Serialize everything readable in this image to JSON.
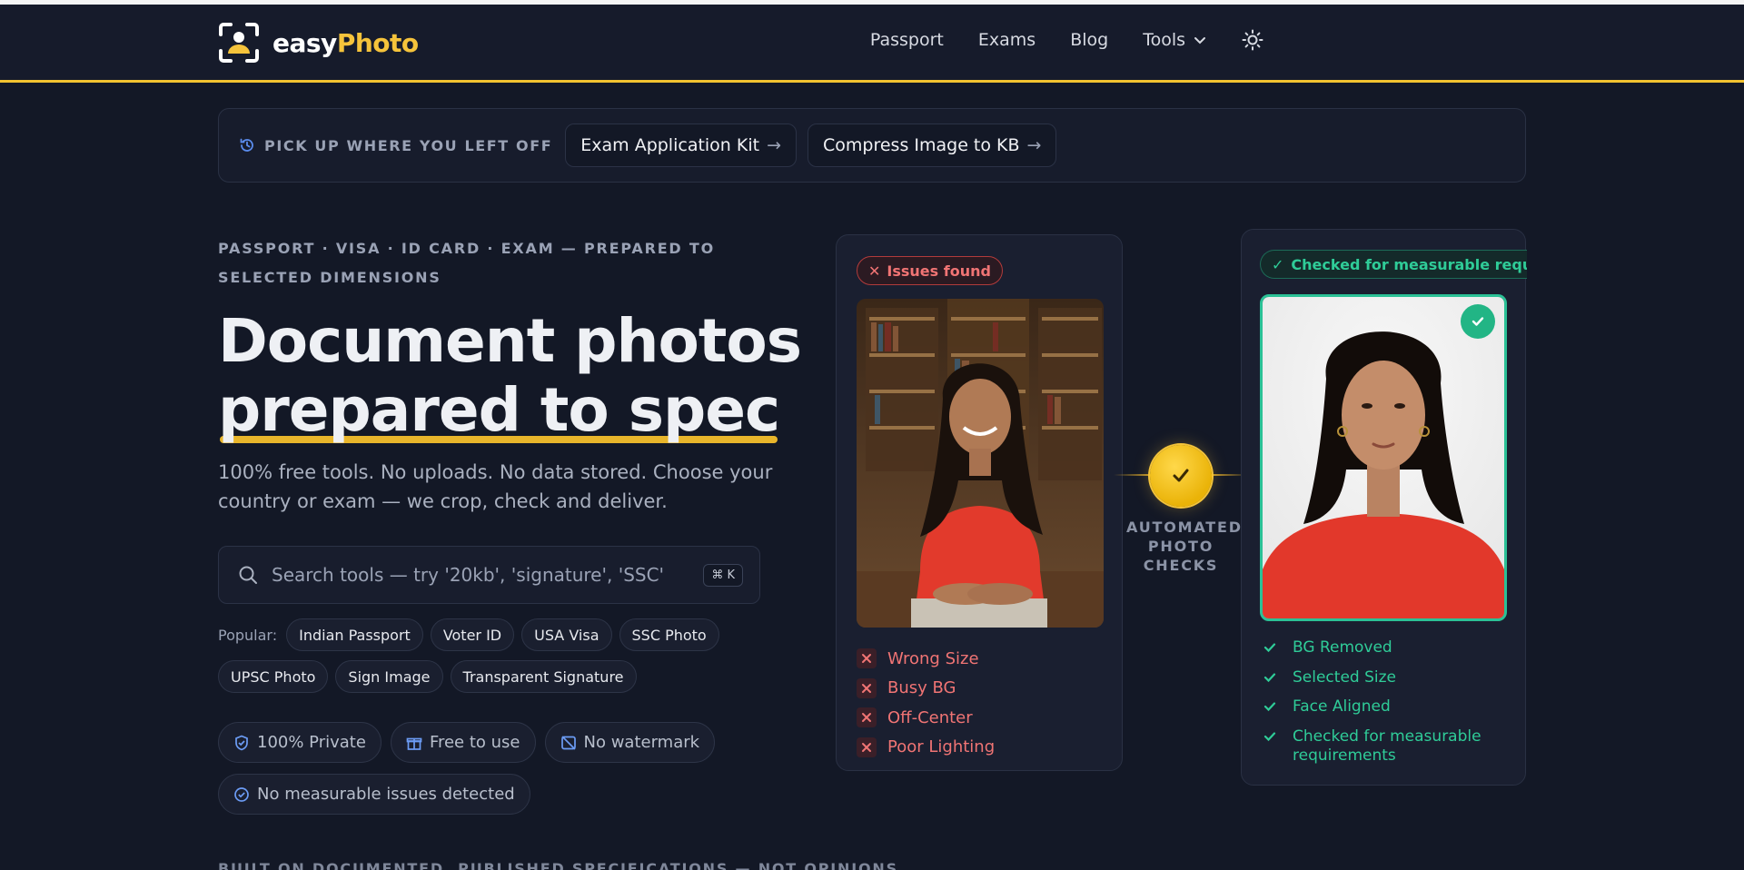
{
  "brand": {
    "name_part1": "easy",
    "name_part2": "Photo",
    "accent": "#f5c33b"
  },
  "nav": {
    "items": [
      {
        "label": "Passport"
      },
      {
        "label": "Exams"
      },
      {
        "label": "Blog"
      },
      {
        "label": "Tools"
      }
    ],
    "theme_icon": "sun-icon"
  },
  "resume": {
    "label": "PICK UP WHERE YOU LEFT OFF",
    "links": [
      {
        "label": "Exam Application Kit"
      },
      {
        "label": "Compress Image to KB"
      }
    ]
  },
  "hero": {
    "eyebrow": "PASSPORT · VISA · ID CARD · EXAM — PREPARED TO SELECTED DIMENSIONS",
    "headline_line1": "Document photos",
    "headline_line2": "prepared to spec",
    "subtext": "100% free tools. No uploads. No data stored. Choose your country or exam — we crop, check and deliver."
  },
  "search": {
    "placeholder": "Search tools — try '20kb', 'signature', 'SSC'",
    "shortcut": "⌘ K"
  },
  "popular": {
    "label": "Popular:",
    "items": [
      "Indian Passport",
      "Voter ID",
      "USA Visa",
      "SSC Photo",
      "UPSC Photo",
      "Sign Image",
      "Transparent Signature"
    ]
  },
  "trust": [
    {
      "label": "100% Private",
      "icon": "shield-icon"
    },
    {
      "label": "Free to use",
      "icon": "gift-icon"
    },
    {
      "label": "No watermark",
      "icon": "no-watermark-icon"
    },
    {
      "label": "No measurable issues detected",
      "icon": "check-circle-icon"
    }
  ],
  "bottom_text": "BUILT ON DOCUMENTED, PUBLISHED SPECIFICATIONS — NOT OPINIONS",
  "before_card": {
    "badge": "Issues found",
    "issues": [
      "Wrong Size",
      "Busy BG",
      "Off-Center",
      "Poor Lighting"
    ]
  },
  "middle": {
    "label": "AUTOMATED PHOTO CHECKS"
  },
  "after_card": {
    "badge": "Checked for measurable requirements",
    "checks": [
      "BG Removed",
      "Selected Size",
      "Face Aligned",
      "Checked for measurable requirements"
    ]
  },
  "colors": {
    "background": "#131826",
    "accent_yellow": "#f5c33b",
    "error_red": "#f07474",
    "success_green": "#2fcc98"
  }
}
